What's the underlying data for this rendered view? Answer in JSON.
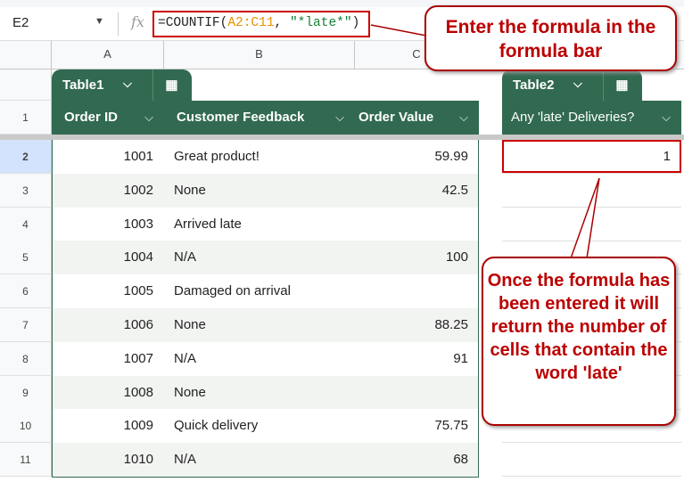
{
  "name_box": "E2",
  "formula": {
    "prefix": "=COUNTIF(",
    "range": "A2:C11",
    "sep": ", ",
    "criteria": "\"*late*\"",
    "suffix": ")"
  },
  "columns": [
    "A",
    "B",
    "C"
  ],
  "table1": {
    "name": "Table1",
    "headers": [
      "Order ID",
      "Customer Feedback",
      "Order Value"
    ],
    "rows": [
      [
        "1001",
        "Great product!",
        "59.99"
      ],
      [
        "1002",
        "None",
        "42.5"
      ],
      [
        "1003",
        "Arrived late",
        ""
      ],
      [
        "1004",
        "N/A",
        "100"
      ],
      [
        "1005",
        "Damaged on arrival",
        ""
      ],
      [
        "1006",
        "None",
        "88.25"
      ],
      [
        "1007",
        "N/A",
        "91"
      ],
      [
        "1008",
        "None",
        ""
      ],
      [
        "1009",
        "Quick delivery",
        "75.75"
      ],
      [
        "1010",
        "N/A",
        "68"
      ]
    ]
  },
  "table2": {
    "name": "Table2",
    "header": "Any 'late' Deliveries?",
    "value": "1"
  },
  "row_numbers": [
    "1",
    "2",
    "3",
    "4",
    "5",
    "6",
    "7",
    "8",
    "9",
    "10",
    "11"
  ],
  "callout1": "Enter the formula in the formula bar",
  "callout2": "Once the formula has been entered it will return the number of cells that contain the word 'late'",
  "colors": {
    "table_header": "#316a50",
    "annotation": "#c00000"
  }
}
